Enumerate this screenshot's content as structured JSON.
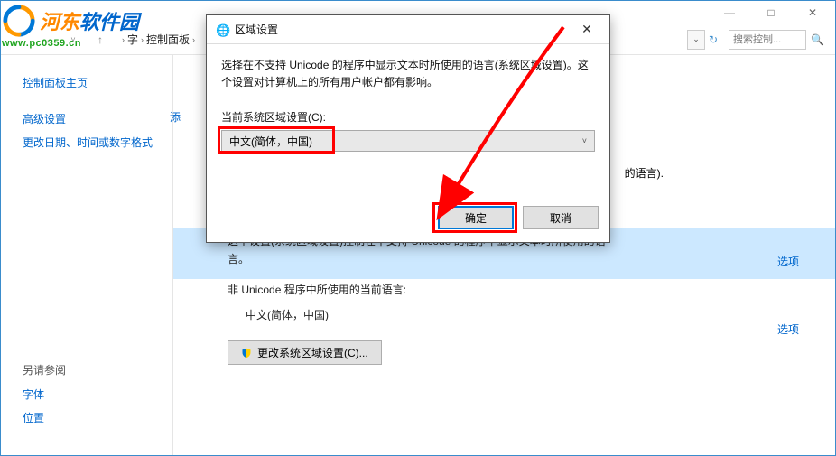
{
  "watermark": {
    "text_part1": "河东",
    "text_part2": "软件园",
    "url": "www.pc0359.cn"
  },
  "bg_window": {
    "btn_min": "—",
    "btn_max": "□",
    "btn_close": "✕",
    "nav": {
      "back": "←",
      "fwd": "→",
      "up": "↑",
      "breadcrumb": [
        "字",
        "控制面板"
      ],
      "dropdown": "⌄",
      "refresh": "↻",
      "search_icon": "🔍",
      "search_placeholder": "搜索控制..."
    },
    "sidebar": {
      "home": "控制面板主页",
      "advanced": "高级设置",
      "change_date": "更改日期、时间或数字格式",
      "footer_label": "另请参阅",
      "font": "字体",
      "location": "位置"
    },
    "content": {
      "partial_left": "添",
      "line1_suffix": "的语言).",
      "block1": "这个设置(系统区域设置)控制在不支持 Unicode 的程序中显示文本时所使用的语言。",
      "heading": "非 Unicode 程序中所使用的当前语言:",
      "current_lang": "中文(简体，中国)",
      "change_btn": "更改系统区域设置(C)...",
      "option": "选项"
    }
  },
  "modal": {
    "title": "区域设置",
    "close": "✕",
    "desc": "选择在不支持 Unicode 的程序中显示文本时所使用的语言(系统区域设置)。这个设置对计算机上的所有用户帐户都有影响。",
    "label": "当前系统区域设置(C):",
    "selected": "中文(简体，中国)",
    "ok": "确定",
    "cancel": "取消"
  }
}
